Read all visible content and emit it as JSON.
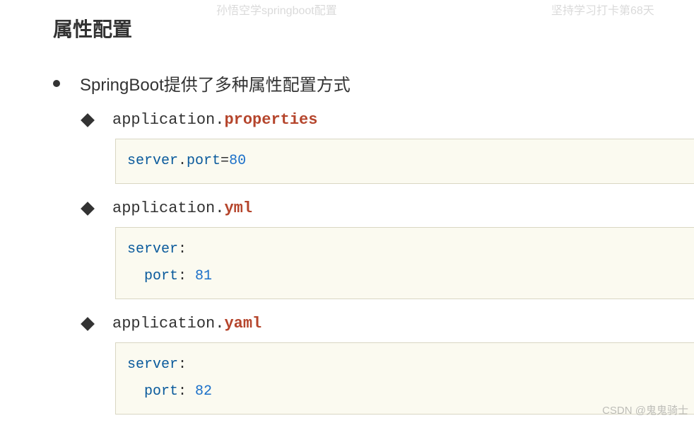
{
  "watermarks": {
    "left": "孙悟空学springboot配置",
    "right": "坚持学习打卡第68天",
    "bottom": "CSDN @鬼鬼骑士"
  },
  "title": "属性配置",
  "bullet_text": "SpringBoot提供了多种属性配置方式",
  "items": [
    {
      "prefix": "application.",
      "ext": "properties",
      "code_lines": [
        "server.port=80"
      ]
    },
    {
      "prefix": "application.",
      "ext": "yml",
      "code_lines": [
        "server:",
        "  port: 81"
      ]
    },
    {
      "prefix": "application.",
      "ext": "yaml",
      "code_lines": [
        "server:",
        "  port: 82"
      ]
    }
  ],
  "code_tokens": {
    "prop": {
      "k1": "server",
      "dot": ".",
      "k2": "port",
      "eq": "=",
      "val": "80"
    },
    "yml": {
      "k1": "server",
      "c1": ":",
      "ind": "  ",
      "k2": "port",
      "c2": ": ",
      "val": "81"
    },
    "yaml": {
      "k1": "server",
      "c1": ":",
      "ind": "  ",
      "k2": "port",
      "c2": ": ",
      "val": "82"
    }
  }
}
